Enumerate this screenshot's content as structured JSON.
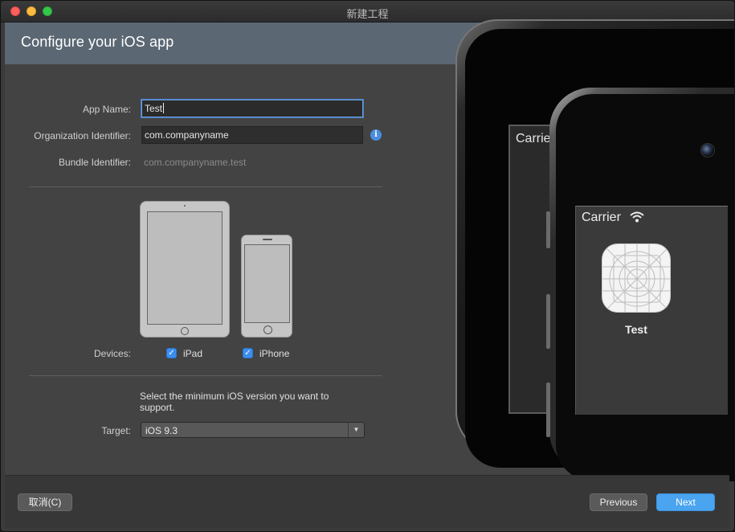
{
  "window": {
    "title": "新建工程"
  },
  "header": {
    "title": "Configure your iOS app"
  },
  "form": {
    "app_name_label": "App Name:",
    "app_name_value": "Test",
    "org_id_label": "Organization Identifier:",
    "org_id_value": "com.companyname",
    "bundle_id_label": "Bundle Identifier:",
    "bundle_id_value": "com.companyname.test",
    "devices_label": "Devices:",
    "device_ipad": {
      "label": "iPad",
      "checked": true
    },
    "device_iphone": {
      "label": "iPhone",
      "checked": true
    },
    "help_text": "Select the minimum iOS version you want to support.",
    "target_label": "Target:",
    "target_value": "iOS 9.3"
  },
  "preview": {
    "tablet_carrier": "Carrier",
    "phone_carrier": "Carrier",
    "app_name": "Test"
  },
  "footer": {
    "cancel_label": "取消(C)",
    "previous_label": "Previous",
    "next_label": "Next"
  },
  "colors": {
    "accent": "#4aa4f0",
    "header_bg": "#5b6773",
    "panel_bg": "#434343"
  }
}
